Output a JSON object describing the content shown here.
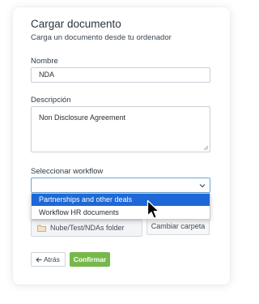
{
  "header": {
    "title": "Cargar documento",
    "subtitle": "Carga un documento desde tu ordenador"
  },
  "form": {
    "name_label": "Nombre",
    "name_value": "NDA",
    "description_label": "Descripción",
    "description_value": "Non Disclosure Agreement",
    "workflow_label": "Seleccionar workflow",
    "workflow_value": "",
    "workflow_options": [
      {
        "label": "Partnerships and other deals",
        "highlighted": true
      },
      {
        "label": "Workflow HR documents",
        "highlighted": false
      }
    ],
    "folder_path": "Nube/Test/NDAs folder",
    "change_folder_label": "Cambiar carpeta"
  },
  "actions": {
    "back_label": "Atrás",
    "confirm_label": "Confirmar"
  },
  "colors": {
    "accent_green": "#77b84b",
    "highlight_blue": "#1d68d6",
    "focus_border": "#6aa5d8"
  }
}
